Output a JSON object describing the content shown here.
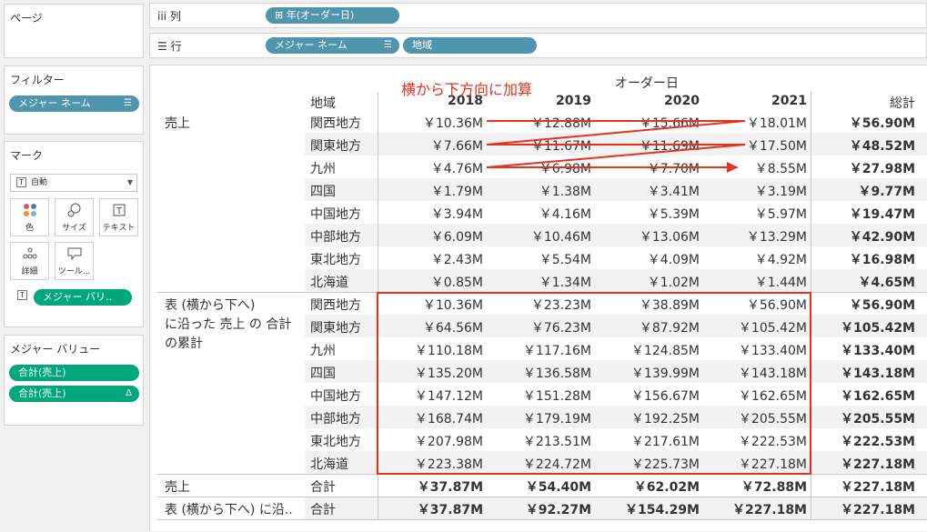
{
  "sidebar": {
    "pages_title": "ページ",
    "filters_title": "フィルター",
    "filter_pill": "メジャー ネーム",
    "marks_title": "マーク",
    "mark_type": "自動",
    "mark_buttons": {
      "color": "色",
      "size": "サイズ",
      "text": "テキスト",
      "detail": "詳細",
      "tooltip": "ツール..."
    },
    "text_pill": "メジャー バリ..",
    "measure_values_title": "メジャー バリュー",
    "measure_pills": [
      "合計(売上)",
      "合計(売上)"
    ]
  },
  "shelves": {
    "columns_label": "列",
    "columns_pill": "年(オーダー日)",
    "rows_label": "行",
    "rows_pills": [
      "メジャー ネーム",
      "地域"
    ]
  },
  "annotation": {
    "text": "横から下方向に加算",
    "color": "#e8301b"
  },
  "table": {
    "col_group_header": "オーダー日",
    "region_header": "地域",
    "years": [
      "2018",
      "2019",
      "2020",
      "2021"
    ],
    "total_header": "総計",
    "measure1": "売上",
    "measure2_lines": [
      "表 (横から下へ)",
      "に沿った 売上 の 合計",
      "の累計"
    ],
    "regions": [
      "関西地方",
      "関東地方",
      "九州",
      "四国",
      "中国地方",
      "中部地方",
      "東北地方",
      "北海道"
    ],
    "sales_rows": [
      [
        "￥10.36M",
        "￥12.88M",
        "￥15.66M",
        "￥18.01M",
        "￥56.90M"
      ],
      [
        "￥7.66M",
        "￥11.67M",
        "￥11.69M",
        "￥17.50M",
        "￥48.52M"
      ],
      [
        "￥4.76M",
        "￥6.98M",
        "￥7.70M",
        "￥8.55M",
        "￥27.98M"
      ],
      [
        "￥1.79M",
        "￥1.38M",
        "￥3.41M",
        "￥3.19M",
        "￥9.77M"
      ],
      [
        "￥3.94M",
        "￥4.16M",
        "￥5.39M",
        "￥5.97M",
        "￥19.47M"
      ],
      [
        "￥6.09M",
        "￥10.46M",
        "￥13.06M",
        "￥13.29M",
        "￥42.90M"
      ],
      [
        "￥2.43M",
        "￥5.54M",
        "￥4.09M",
        "￥4.92M",
        "￥16.98M"
      ],
      [
        "￥0.85M",
        "￥1.34M",
        "￥1.02M",
        "￥1.44M",
        "￥4.65M"
      ]
    ],
    "running_rows": [
      [
        "￥10.36M",
        "￥23.23M",
        "￥38.89M",
        "￥56.90M",
        "￥56.90M"
      ],
      [
        "￥64.56M",
        "￥76.23M",
        "￥87.92M",
        "￥105.42M",
        "￥105.42M"
      ],
      [
        "￥110.18M",
        "￥117.16M",
        "￥124.85M",
        "￥133.40M",
        "￥133.40M"
      ],
      [
        "￥135.20M",
        "￥136.58M",
        "￥139.99M",
        "￥143.18M",
        "￥143.18M"
      ],
      [
        "￥147.12M",
        "￥151.28M",
        "￥156.67M",
        "￥162.65M",
        "￥162.65M"
      ],
      [
        "￥168.74M",
        "￥179.19M",
        "￥192.25M",
        "￥205.55M",
        "￥205.55M"
      ],
      [
        "￥207.98M",
        "￥213.51M",
        "￥217.61M",
        "￥222.53M",
        "￥222.53M"
      ],
      [
        "￥223.38M",
        "￥224.72M",
        "￥225.73M",
        "￥227.18M",
        "￥227.18M"
      ]
    ],
    "total_label": "合計",
    "grand_rows": [
      {
        "label": "売上",
        "values": [
          "￥37.87M",
          "￥54.40M",
          "￥62.02M",
          "￥72.88M",
          "￥227.18M"
        ]
      },
      {
        "label": "表 (横から下へ) に沿..",
        "values": [
          "￥37.87M",
          "￥92.27M",
          "￥154.29M",
          "￥227.18M",
          "￥227.18M"
        ]
      }
    ]
  }
}
